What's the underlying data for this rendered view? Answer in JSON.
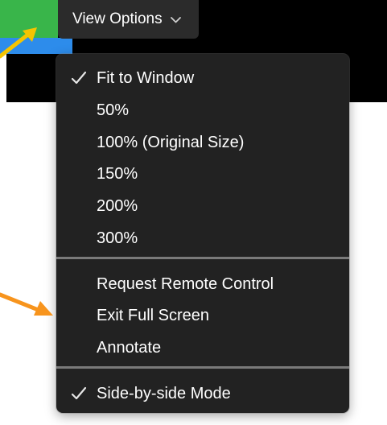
{
  "header": {
    "view_options_label": "View Options"
  },
  "menu": {
    "items": [
      {
        "label": "Fit to Window",
        "checked": true
      },
      {
        "label": "50%",
        "checked": false
      },
      {
        "label": "100% (Original Size)",
        "checked": false
      },
      {
        "label": "150%",
        "checked": false
      },
      {
        "label": "200%",
        "checked": false
      },
      {
        "label": "300%",
        "checked": false
      },
      {
        "label": "Request Remote Control",
        "checked": false
      },
      {
        "label": "Exit Full Screen",
        "checked": false
      },
      {
        "label": "Annotate",
        "checked": false
      },
      {
        "label": "Side-by-side Mode",
        "checked": true
      }
    ]
  },
  "colors": {
    "menu_bg": "#222222",
    "button_bg": "#2b2b2b",
    "green_tile": "#39b54a",
    "blue_tile": "#2d8ceb",
    "arrow_yellow": "#f5c400",
    "arrow_orange": "#f7941d"
  },
  "icons": {
    "check": "checkmark-icon",
    "chevron": "chevron-down-icon",
    "arrow": "callout-arrow-icon"
  }
}
